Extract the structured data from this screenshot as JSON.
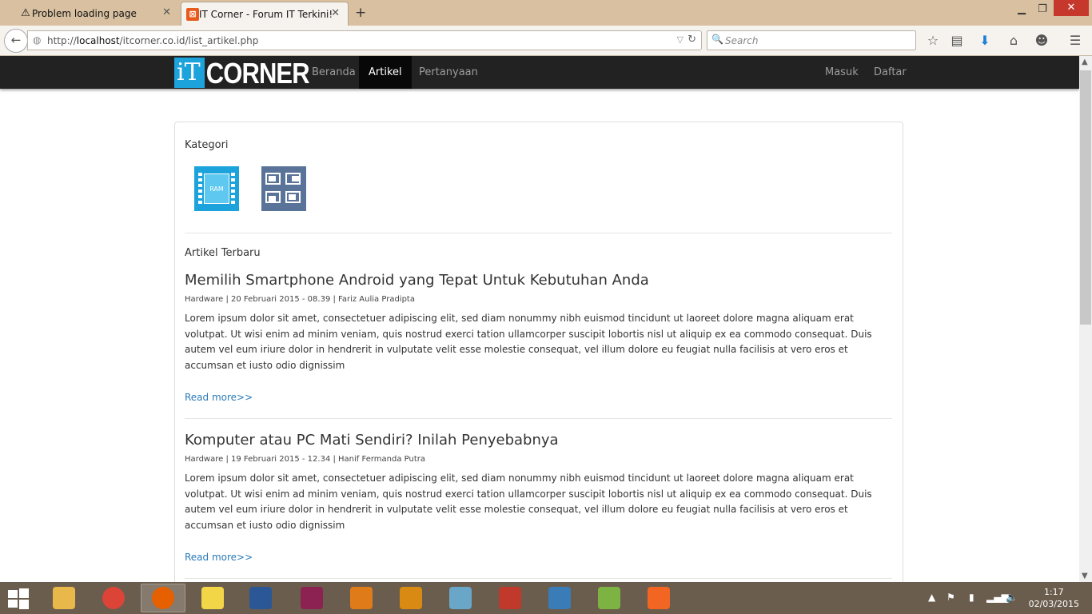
{
  "browser": {
    "tabs": [
      {
        "title": "Problem loading page",
        "icon": "warning-icon"
      },
      {
        "title": "IT Corner - Forum IT Terkini!",
        "icon": "xampp-icon"
      }
    ],
    "url_prefix": "http://",
    "url_host": "localhost",
    "url_path": "/itcorner.co.id/list_artikel.php",
    "search_placeholder": "Search"
  },
  "site": {
    "logo_it": "iT",
    "logo_corner": "CORNER",
    "nav": [
      {
        "label": "Beranda",
        "active": false
      },
      {
        "label": "Artikel",
        "active": true
      },
      {
        "label": "Pertanyaan",
        "active": false
      }
    ],
    "auth": {
      "login": "Masuk",
      "register": "Daftar"
    }
  },
  "main": {
    "kategori_title": "Kategori",
    "categories": [
      {
        "icon": "ram-icon",
        "label": "RAM"
      },
      {
        "icon": "software-icon",
        "label": ""
      }
    ],
    "terbaru_title": "Artikel Terbaru",
    "articles": [
      {
        "title": "Memilih Smartphone Android yang Tepat Untuk Kebutuhan Anda",
        "meta": "Hardware | 20 Februari 2015 - 08.39 | Fariz Aulia Pradipta",
        "body": "Lorem ipsum dolor sit amet, consectetuer adipiscing elit, sed diam nonummy nibh euismod tincidunt ut laoreet dolore magna aliquam erat volutpat. Ut wisi enim ad minim veniam, quis nostrud exerci tation ullamcorper suscipit lobortis nisl ut aliquip ex ea commodo consequat. Duis autem vel eum iriure dolor in hendrerit in vulputate velit esse molestie consequat, vel illum dolore eu feugiat nulla facilisis at vero eros et accumsan et iusto odio dignissim",
        "read_more": "Read more>>"
      },
      {
        "title": "Komputer atau PC Mati Sendiri? Inilah Penyebabnya",
        "meta": "Hardware | 19 Februari 2015 - 12.34 | Hanif Fermanda Putra",
        "body": "Lorem ipsum dolor sit amet, consectetuer adipiscing elit, sed diam nonummy nibh euismod tincidunt ut laoreet dolore magna aliquam erat volutpat. Ut wisi enim ad minim veniam, quis nostrud exerci tation ullamcorper suscipit lobortis nisl ut aliquip ex ea commodo consequat. Duis autem vel eum iriure dolor in hendrerit in vulputate velit esse molestie consequat, vel illum dolore eu feugiat nulla facilisis at vero eros et accumsan et iusto odio dignissim",
        "read_more": "Read more>>"
      }
    ]
  },
  "taskbar": {
    "apps": [
      {
        "name": "file-explorer-icon",
        "color": "#e8b84a"
      },
      {
        "name": "chrome-icon",
        "color": "#db4437"
      },
      {
        "name": "firefox-icon",
        "color": "#e66000"
      },
      {
        "name": "sticky-notes-icon",
        "color": "#f3d648"
      },
      {
        "name": "word-icon",
        "color": "#2b5797"
      },
      {
        "name": "winrar-icon",
        "color": "#8b2252"
      },
      {
        "name": "media-player-icon",
        "color": "#e07b1a"
      },
      {
        "name": "music-app-icon",
        "color": "#d88a12"
      },
      {
        "name": "notepad-icon",
        "color": "#6aa6c8"
      },
      {
        "name": "paint-icon",
        "color": "#c0392b"
      },
      {
        "name": "photo-viewer-icon",
        "color": "#3a7cb8"
      },
      {
        "name": "notepad-plus-icon",
        "color": "#7cb342"
      },
      {
        "name": "xampp-control-icon",
        "color": "#f26522"
      }
    ],
    "time": "1:17",
    "date": "02/03/2015"
  }
}
